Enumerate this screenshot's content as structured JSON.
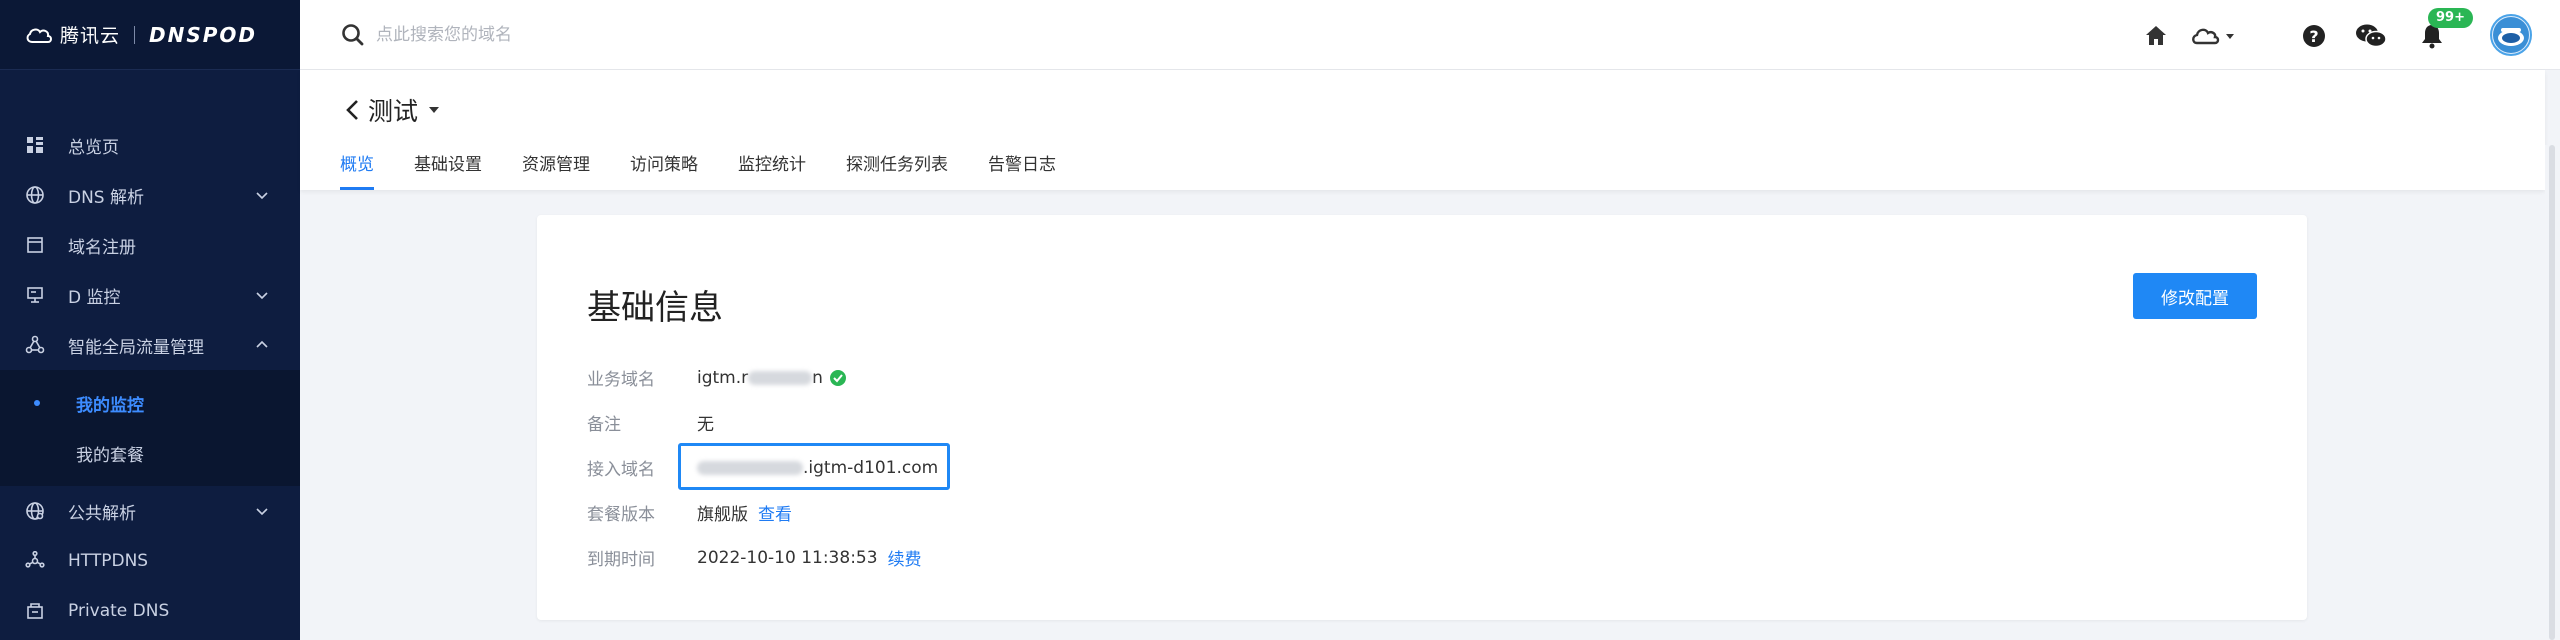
{
  "sidebar": {
    "brand": "腾讯云",
    "product": "DNSPOD",
    "items": [
      {
        "label": "总览页",
        "icon": "grid-icon"
      },
      {
        "label": "DNS 解析",
        "icon": "globe-icon",
        "expandable": true
      },
      {
        "label": "域名注册",
        "icon": "window-icon"
      },
      {
        "label": "D 监控",
        "icon": "monitor-icon",
        "expandable": true
      },
      {
        "label": "智能全局流量管理",
        "icon": "nodes-icon",
        "expanded": true
      }
    ],
    "subitems": [
      {
        "label": "我的监控",
        "active": true
      },
      {
        "label": "我的套餐"
      }
    ],
    "items_after": [
      {
        "label": "公共解析",
        "icon": "globe-net-icon",
        "expandable": true
      },
      {
        "label": "HTTPDNS",
        "icon": "share-icon"
      },
      {
        "label": "Private DNS",
        "icon": "building-icon"
      }
    ]
  },
  "topbar": {
    "search_placeholder": "点此搜索您的域名",
    "notification_badge": "99+"
  },
  "page": {
    "title": "测试",
    "tabs": [
      "概览",
      "基础设置",
      "资源管理",
      "访问策略",
      "监控统计",
      "探测任务列表",
      "告警日志"
    ],
    "active_tab": "概览"
  },
  "card": {
    "title": "基础信息",
    "edit_button": "修改配置",
    "rows": [
      {
        "label": "业务域名",
        "value_prefix": "igtm.r",
        "value_suffix": "n"
      },
      {
        "label": "备注",
        "value": "无"
      },
      {
        "label": "接入域名",
        "value_suffix": ".igtm-d101.com"
      },
      {
        "label": "套餐版本",
        "value": "旗舰版",
        "link": "查看"
      },
      {
        "label": "到期时间",
        "value": "2022-10-10 11:38:53",
        "link": "续费"
      }
    ]
  },
  "colors": {
    "accent": "#1f7bf3",
    "sidebar_bg": "#0e1d40",
    "success": "#2ab654"
  }
}
